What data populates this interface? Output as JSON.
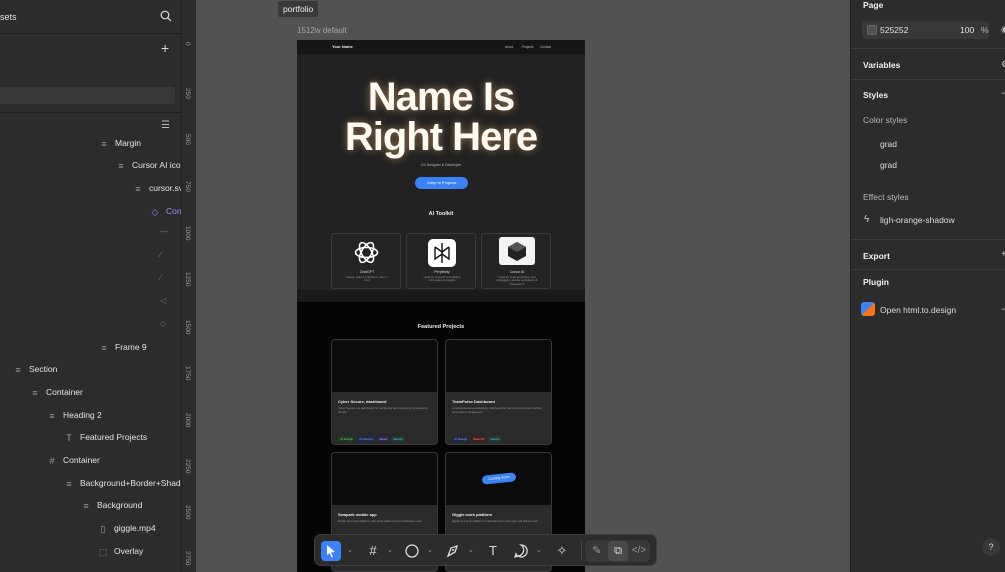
{
  "left_panel": {
    "header_label": "sets",
    "layers": [
      {
        "label": "Margin",
        "icon": "≡"
      },
      {
        "label": "Cursor AI ico",
        "icon": "≡"
      },
      {
        "label": "cursor.sv",
        "icon": "≡"
      },
      {
        "label": "Com",
        "icon": "◇"
      },
      {
        "label": "Frame 9",
        "icon": "≡"
      },
      {
        "label": "Section",
        "icon": "≡"
      },
      {
        "label": "Container",
        "icon": "≡"
      },
      {
        "label": "Heading 2",
        "icon": "≡"
      },
      {
        "label": "Featured Projects",
        "icon": "T"
      },
      {
        "label": "Container",
        "icon": "#"
      },
      {
        "label": "Background+Border+Shadow",
        "icon": "≡"
      },
      {
        "label": "Background",
        "icon": "≡"
      },
      {
        "label": "giggle.mp4",
        "icon": "▯"
      },
      {
        "label": "Overlay",
        "icon": "⬚"
      }
    ]
  },
  "ruler": {
    "ticks": [
      "0",
      "250",
      "500",
      "750",
      "1000",
      "1250",
      "1500",
      "1750",
      "2000",
      "2250",
      "2500",
      "2750"
    ]
  },
  "canvas": {
    "frame_name": "portfolio",
    "frame_variant": "1512w default",
    "site": {
      "nav_name": "Your Name",
      "nav_links": [
        "About",
        "Projects",
        "Contact"
      ],
      "hero_title_line1": "Name Is",
      "hero_title_line2": "Right Here",
      "hero_subtitle": "UX Designer & Developer",
      "hero_button": "Jump to Projects",
      "toolkit_title": "AI Toolkit",
      "toolkit_cards": [
        {
          "name": "ChatGPT",
          "desc": "Ideate, write & brainstorm, test in copy"
        },
        {
          "name": "Perplexity",
          "desc": "Used for research and finding information & insights"
        },
        {
          "name": "Cursor AI",
          "desc": "Used for code generation and debugging, also for animations & interactions"
        }
      ],
      "projects_title": "Featured Projects",
      "projects": [
        {
          "title": "Cyber Secure, dashboard",
          "desc": "Cyber Secure is a dashboard for monitoring and managing cybersecurity threats.",
          "tags": [
            "UI Design",
            "UX Design",
            "React",
            "Next.js"
          ]
        },
        {
          "title": "TeamPulse Dashboard",
          "desc": "A comprehensive productivity dashboard for teams performance tracking and project management.",
          "tags": [
            "UI Design",
            "Data Viz",
            "Next.js"
          ]
        },
        {
          "title": "Swapark mobile app",
          "desc": "Mobile-first travel platform with personalized recommendations and",
          "tags": []
        },
        {
          "title": "Giggle work platform",
          "desc": "Giggle is a work platform for Freelancers to find gigs and deliver work.",
          "tags": []
        }
      ],
      "coming_soon_badge": "Coming Soon"
    }
  },
  "right_panel": {
    "page_section": "Page",
    "page_color_hex": "525252",
    "page_opacity": "100",
    "page_opacity_unit": "%",
    "variables": "Variables",
    "styles": "Styles",
    "color_styles": "Color styles",
    "color_style_items": [
      "grad",
      "grad"
    ],
    "effect_styles": "Effect styles",
    "effect_style_item": "ligh-orange-shadow",
    "export": "Export",
    "plugin": "Plugin",
    "plugin_item": "Open html.to.design"
  },
  "toolbar": {
    "tools": [
      "move-tool",
      "frame-tool",
      "shape-tool",
      "pen-tool",
      "text-tool",
      "comment-tool",
      "actions-tool",
      "draw-mode",
      "design-mode",
      "dev-mode"
    ]
  },
  "help_label": "?",
  "colors": {
    "accent": "#3b82f6",
    "panel": "#2c2c2c",
    "canvas": "#525252"
  }
}
